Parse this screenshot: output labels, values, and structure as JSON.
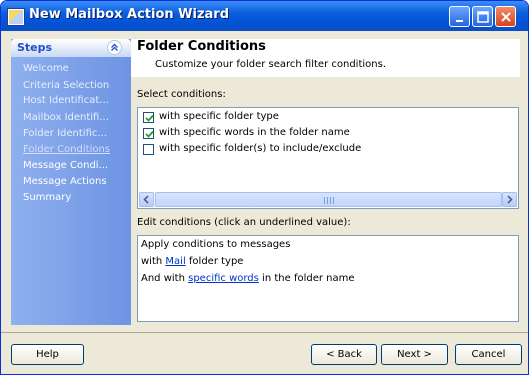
{
  "window": {
    "title": "New Mailbox Action Wizard"
  },
  "sidebar": {
    "title": "Steps",
    "items": [
      {
        "label": "Welcome",
        "state": "done"
      },
      {
        "label": "Criteria Selection",
        "state": "done"
      },
      {
        "label": "Host Identificat...",
        "state": "done"
      },
      {
        "label": "Mailbox Identifi...",
        "state": "done"
      },
      {
        "label": "Folder Identific...",
        "state": "done"
      },
      {
        "label": "Folder Conditions",
        "state": "active"
      },
      {
        "label": "Message Condi...",
        "state": "pending"
      },
      {
        "label": "Message Actions",
        "state": "pending"
      },
      {
        "label": "Summary",
        "state": "pending"
      }
    ]
  },
  "page": {
    "title": "Folder Conditions",
    "subtitle": "Customize your folder search filter conditions."
  },
  "conditions": {
    "label": "Select conditions:",
    "items": [
      {
        "label": "with specific folder type",
        "checked": true
      },
      {
        "label": "with specific words in the folder name",
        "checked": true
      },
      {
        "label": "with specific folder(s) to include/exclude",
        "checked": false
      }
    ]
  },
  "edit": {
    "label": "Edit conditions (click an underlined value):",
    "line1": "Apply conditions to messages",
    "line2_pre": "with ",
    "line2_link": "Mail",
    "line2_post": " folder type",
    "line3_pre": "And with ",
    "line3_link": "specific words",
    "line3_post": " in the folder name"
  },
  "buttons": {
    "help": "Help",
    "back": "< Back",
    "next": "Next >",
    "cancel": "Cancel"
  },
  "colors": {
    "titlebar": "#0a5fdc",
    "sidebar": "#6d93e3",
    "link": "#0033cc"
  }
}
